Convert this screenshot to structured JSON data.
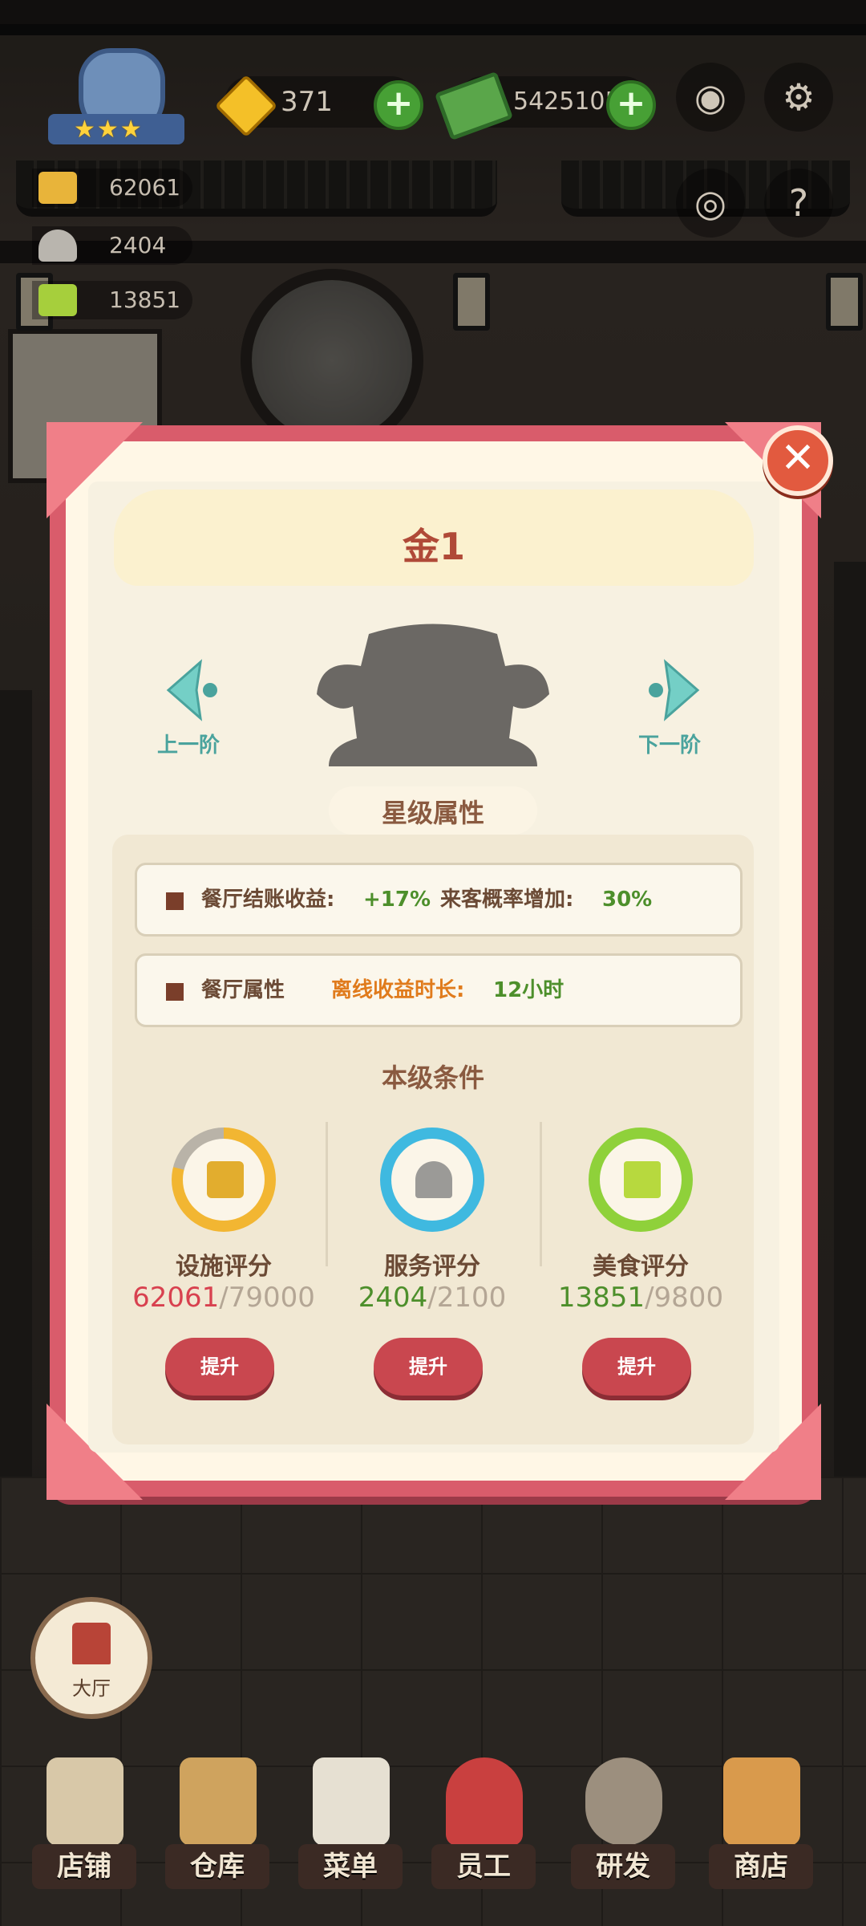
{
  "hud": {
    "gems": "371",
    "cash": "5425105",
    "facility_stat": "62061",
    "service_stat": "2404",
    "food_stat": "13851",
    "level_stars": 3
  },
  "modal": {
    "title": "金1",
    "prev_label": "上一阶",
    "next_label": "下一阶",
    "star_attr_title": "星级属性",
    "attr1_label": "餐厅结账收益:",
    "attr1_value": "+17%",
    "attr1b_label": "来客概率增加:",
    "attr1b_value": "30%",
    "attr2_label": "餐厅属性",
    "attr2_name": "离线收益时长:",
    "attr2_value": "12小时",
    "conditions_title": "本级条件",
    "metrics": [
      {
        "name": "设施评分",
        "current": "62061",
        "required": "79000",
        "button": "提升",
        "ring_color": "#f2b632",
        "progress": 0.79
      },
      {
        "name": "服务评分",
        "current": "2404",
        "required": "2100",
        "button": "提升",
        "ring_color": "#3fb9e0",
        "progress": 1.0
      },
      {
        "name": "美食评分",
        "current": "13851",
        "required": "9800",
        "button": "提升",
        "ring_color": "#8fd13a",
        "progress": 1.0
      }
    ]
  },
  "hall_label": "大厅",
  "bottom_nav": [
    "店铺",
    "仓库",
    "菜单",
    "员工",
    "研发",
    "商店"
  ]
}
